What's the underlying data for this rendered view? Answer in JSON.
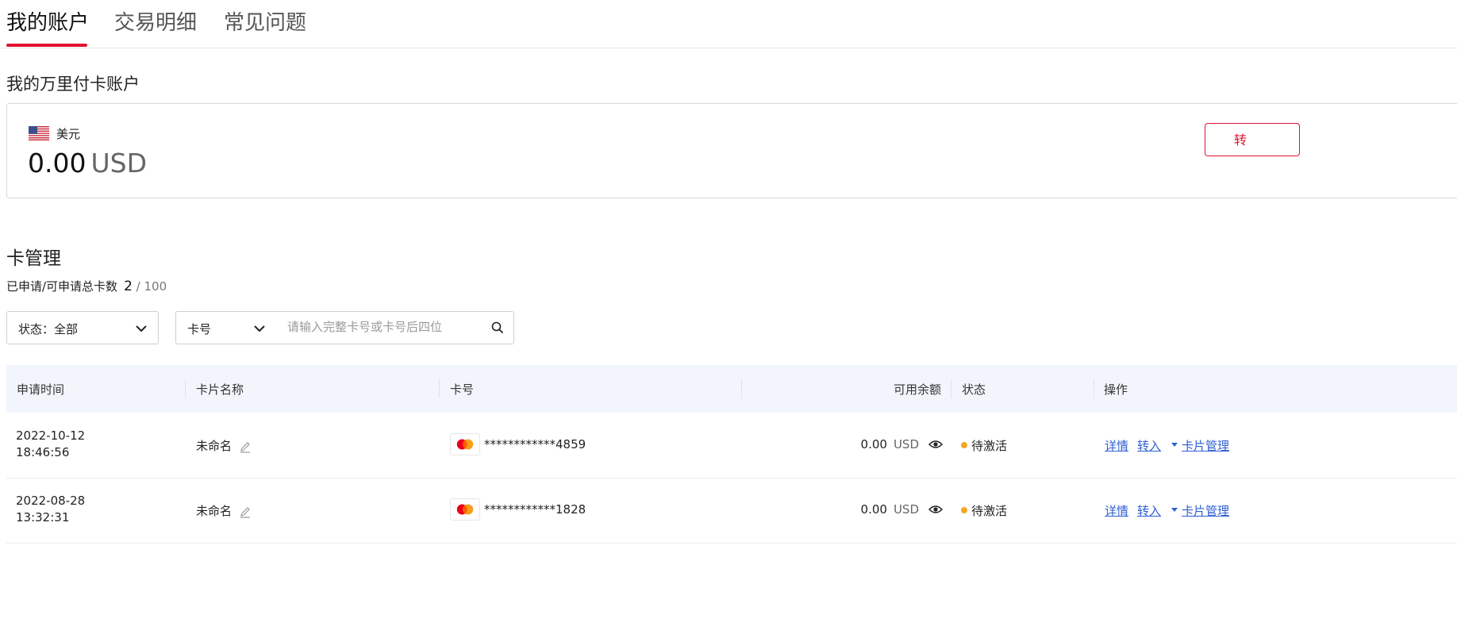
{
  "tabs": [
    {
      "label": "我的账户"
    },
    {
      "label": "交易明细"
    },
    {
      "label": "常见问题"
    }
  ],
  "account_section": {
    "title": "我的万里付卡账户",
    "currency_label": "美元",
    "balance": "0.00",
    "unit": "USD",
    "transfer_label": "转"
  },
  "card_mgmt": {
    "title": "卡管理",
    "count_label": "已申请/可申请总卡数",
    "count": "2",
    "total": "/ 100"
  },
  "filters": {
    "status_label": "状态：全部",
    "type_label": "卡号",
    "search_placeholder": "请输入完整卡号或卡号后四位"
  },
  "table": {
    "headers": [
      "申请时间",
      "卡片名称",
      "卡号",
      "可用余额",
      "状态",
      "操作"
    ],
    "rows": [
      {
        "date": "2022-10-12",
        "time": "18:46:56",
        "name": "未命名",
        "card": "************4859",
        "amount": "0.00",
        "unit": "USD",
        "status": "待激活",
        "actions": [
          "详情",
          "转入",
          "卡片管理"
        ]
      },
      {
        "date": "2022-08-28",
        "time": "13:32:31",
        "name": "未命名",
        "card": "************1828",
        "amount": "0.00",
        "unit": "USD",
        "status": "待激活",
        "actions": [
          "详情",
          "转入",
          "卡片管理"
        ]
      }
    ]
  },
  "colors": {
    "accent": "#e0142f",
    "link": "#2f5fd1",
    "status_pending": "#f5a623",
    "table_header_bg": "#f2f6fc"
  },
  "icons": [
    "us-flag-icon",
    "chevron-down-icon",
    "search-icon",
    "pencil-icon",
    "mastercard-icon",
    "eye-icon",
    "caret-down-icon"
  ]
}
